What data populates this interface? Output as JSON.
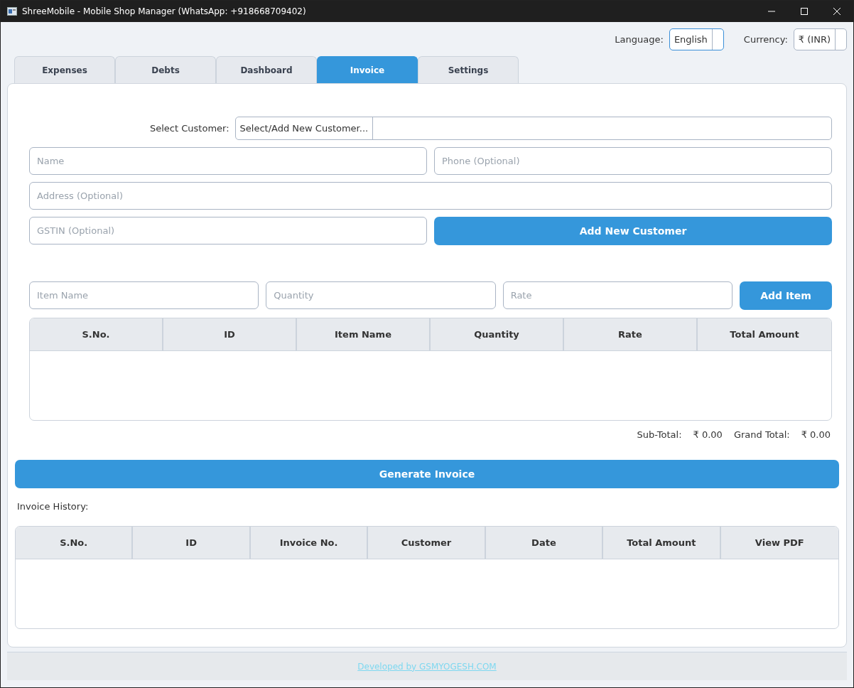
{
  "window": {
    "title": "ShreeMobile - Mobile Shop Manager (WhatsApp: +918668709402)"
  },
  "top_bar": {
    "language": {
      "label": "Language:",
      "value": "English"
    },
    "currency": {
      "label": "Currency:",
      "value": "₹ (INR)"
    }
  },
  "tabs": [
    {
      "label": "Expenses",
      "selected": false
    },
    {
      "label": "Debts",
      "selected": false
    },
    {
      "label": "Dashboard",
      "selected": false
    },
    {
      "label": "Invoice",
      "selected": true
    },
    {
      "label": "Settings",
      "selected": false
    }
  ],
  "customer_form": {
    "select_label": "Select Customer:",
    "select_value": "Select/Add New Customer...",
    "name": {
      "placeholder": "Name"
    },
    "phone": {
      "placeholder": "Phone (Optional)"
    },
    "address": {
      "placeholder": "Address (Optional)"
    },
    "gstin": {
      "placeholder": "GSTIN (Optional)"
    },
    "add_button": "Add New Customer"
  },
  "item_form": {
    "item_name": {
      "placeholder": "Item Name"
    },
    "quantity": {
      "placeholder": "Quantity"
    },
    "rate": {
      "placeholder": "Rate"
    },
    "add_button": "Add Item"
  },
  "items_table": {
    "columns": [
      "S.No.",
      "ID",
      "Item Name",
      "Quantity",
      "Rate",
      "Total Amount"
    ]
  },
  "totals": {
    "sub_total_label": "Sub-Total:",
    "sub_total": "₹  0.00",
    "grand_total_label": "Grand Total:",
    "grand_total": "₹  0.00"
  },
  "generate_button": "Generate Invoice",
  "history": {
    "label": "Invoice History:",
    "columns": [
      "S.No.",
      "ID",
      "Invoice No.",
      "Customer",
      "Date",
      "Total Amount",
      "View PDF"
    ]
  },
  "footer": {
    "link": "Developed by GSMYOGESH.COM"
  }
}
